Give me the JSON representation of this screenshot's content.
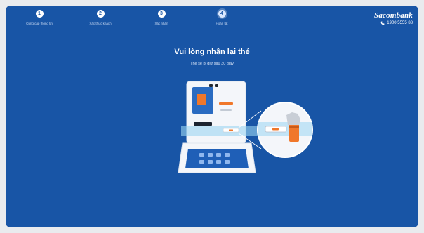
{
  "steps": [
    {
      "number": "1",
      "label": "Cung cấp thông tin"
    },
    {
      "number": "2",
      "label": "Xác thực khách"
    },
    {
      "number": "3",
      "label": "Xác nhận"
    },
    {
      "number": "4",
      "label": "Hoàn tất"
    }
  ],
  "active_step": 4,
  "brand": {
    "name": "Sacombank",
    "phone": "1900 5555 88"
  },
  "title": "Vui lòng nhận lại thẻ",
  "subtitle": "Thẻ sẽ bị giữ sau 30 giây",
  "colors": {
    "background": "#1855a6",
    "accent": "#f0772a",
    "highlight": "#9bd6f2"
  },
  "icons": {
    "phone": "phone-icon",
    "illustration": "atm-card-return-illustration"
  }
}
